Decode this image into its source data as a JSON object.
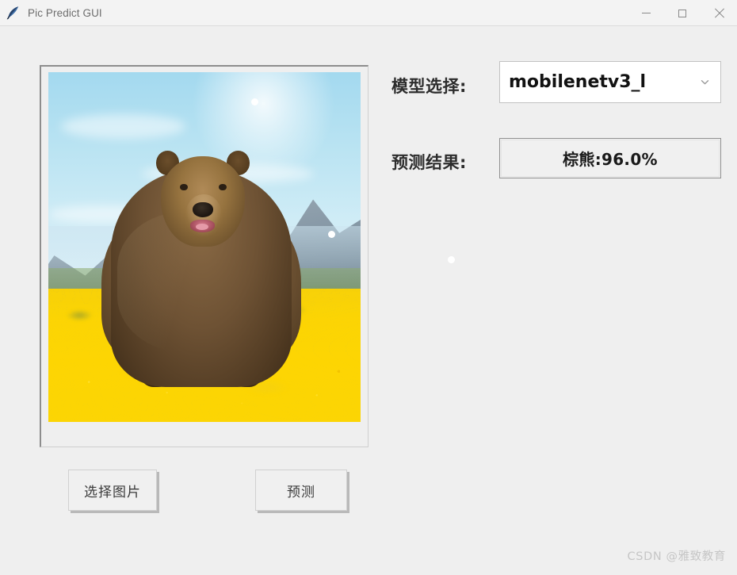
{
  "window": {
    "title": "Pic Predict GUI",
    "icon": "feather-icon",
    "controls": {
      "minimize": "minimize-icon",
      "maximize": "maximize-icon",
      "close": "close-icon"
    }
  },
  "image_panel": {
    "alt": "Brown bear standing in a field of yellow wildflowers with mountains and blue sky",
    "subject": "brown bear"
  },
  "form": {
    "model_label": "模型选择:",
    "model_value": "mobilenetv3_l",
    "model_arrow_icon": "chevron-down-icon",
    "result_label": "预测结果:",
    "result_value": "棕熊:96.0%"
  },
  "buttons": {
    "select_image": "选择图片",
    "predict": "预测"
  },
  "watermark": {
    "text": "CSDN @雅致教育"
  },
  "colors": {
    "window_background": "#efefef",
    "titlebar_background": "#f3f3f3",
    "title_text": "#6d6d6d",
    "label_text": "#2c2c2c",
    "combobox_background": "#ffffff",
    "combobox_border": "#c2c2c2",
    "result_background": "#f0f0f0",
    "result_border": "#909090",
    "button_background": "#f0f0f0",
    "button_shadow": "#b9b9b9",
    "watermark_text": "#c6c6c6"
  }
}
